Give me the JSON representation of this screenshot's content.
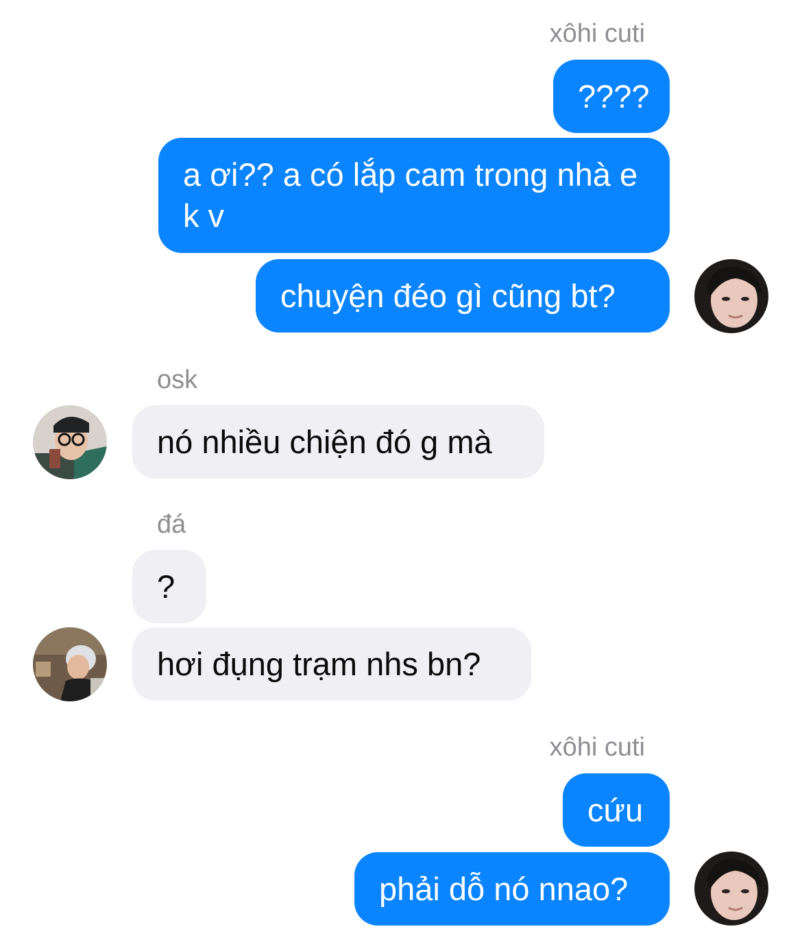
{
  "messages": [
    {
      "sender": "xôhi cuti"
    },
    {
      "text": "????"
    },
    {
      "text": "a ơi?? a có lắp cam trong nhà e k v"
    },
    {
      "text": "chuyện đéo gì cũng bt?"
    },
    {
      "sender": "osk"
    },
    {
      "text": "nó nhiều chiện đó g mà"
    },
    {
      "sender": "đá"
    },
    {
      "text": "?"
    },
    {
      "text": "hơi đụng trạm nhs bn?"
    },
    {
      "sender": "xôhi cuti"
    },
    {
      "text": "cứu"
    },
    {
      "text": "phải dỗ nó nnao?"
    }
  ],
  "colors": {
    "outgoing_bubble": "#0a84ff",
    "incoming_bubble": "#efeff4",
    "sender_label": "#8e8e93"
  }
}
